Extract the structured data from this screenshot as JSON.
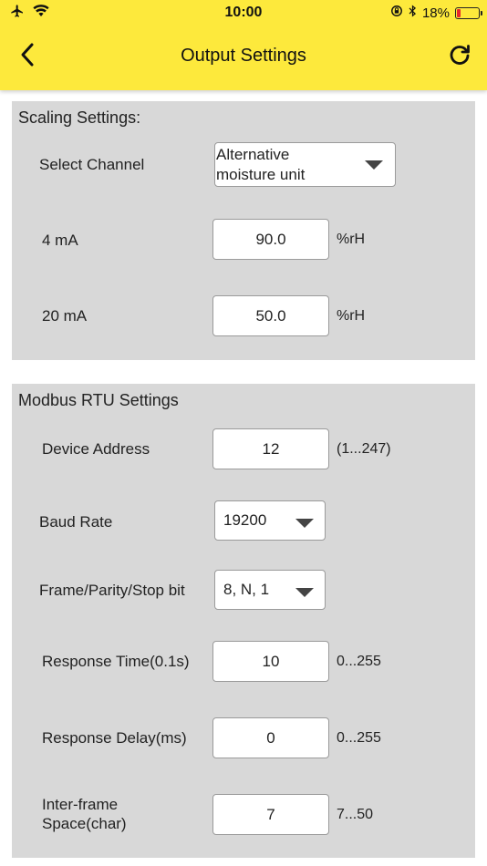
{
  "status_bar": {
    "time": "10:00",
    "battery_percent": "18%",
    "battery_level": 0.18
  },
  "header": {
    "title": "Output Settings",
    "back_icon": "chevron-left-icon",
    "refresh_icon": "refresh-icon"
  },
  "scaling": {
    "title": "Scaling Settings:",
    "channel_label": "Select Channel",
    "channel_value": "Alternative\nmoisture unit",
    "ma4_label": "4 mA",
    "ma4_value": "90.0",
    "ma4_unit": "%rH",
    "ma20_label": "20 mA",
    "ma20_value": "50.0",
    "ma20_unit": "%rH"
  },
  "modbus": {
    "title": "Modbus RTU Settings",
    "device_address_label": "Device Address",
    "device_address_value": "12",
    "device_address_range": "(1...247)",
    "baud_rate_label": "Baud Rate",
    "baud_rate_value": "19200",
    "frame_label": "Frame/Parity/Stop bit",
    "frame_value": "8, N, 1",
    "response_time_label": "Response Time(0.1s)",
    "response_time_value": "10",
    "response_time_range": "0...255",
    "response_delay_label": "Response Delay(ms)",
    "response_delay_value": "0",
    "response_delay_range": "0...255",
    "interframe_label": "Inter-frame\nSpace(char)",
    "interframe_value": "7",
    "interframe_range": "7...50"
  },
  "colors": {
    "header_bg": "#fde93c",
    "panel_bg": "#d8d8d8",
    "battery_low": "#e8262b"
  }
}
